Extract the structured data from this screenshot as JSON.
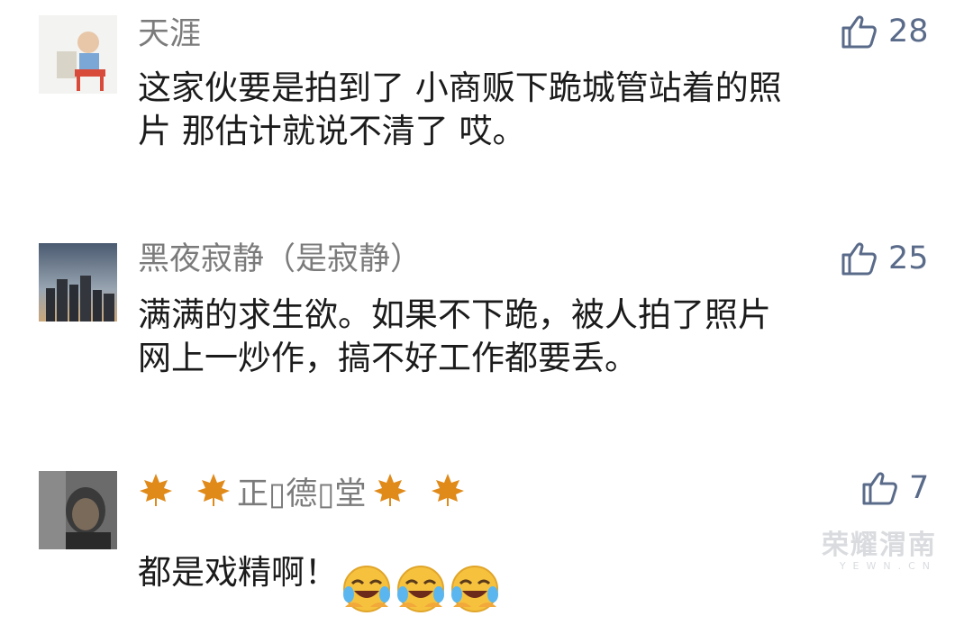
{
  "comments": [
    {
      "name": "天涯",
      "text": "这家伙要是拍到了 小商贩下跪城管站着的照\n片 那估计就说不清了 哎。",
      "likes": "28"
    },
    {
      "name": "黑夜寂静（是寂静）",
      "text": "满满的求生欲。如果不下跪，被人拍了照片\n网上一炒作，搞不好工作都要丢。",
      "likes": "25"
    },
    {
      "name": "正▯德▯堂",
      "text": "都是戏精啊！",
      "likes": "7"
    }
  ],
  "icons": {
    "like": "thumbs-up-icon",
    "leaf": "maple-leaf-icon",
    "emoji": "laughing-crying-emoji"
  },
  "watermark": {
    "main": "荣耀渭南",
    "sub": "YEWN.CN"
  },
  "colors": {
    "name": "#7b7b7b",
    "text": "#1b1b1b",
    "like": "#5a6b8a"
  }
}
